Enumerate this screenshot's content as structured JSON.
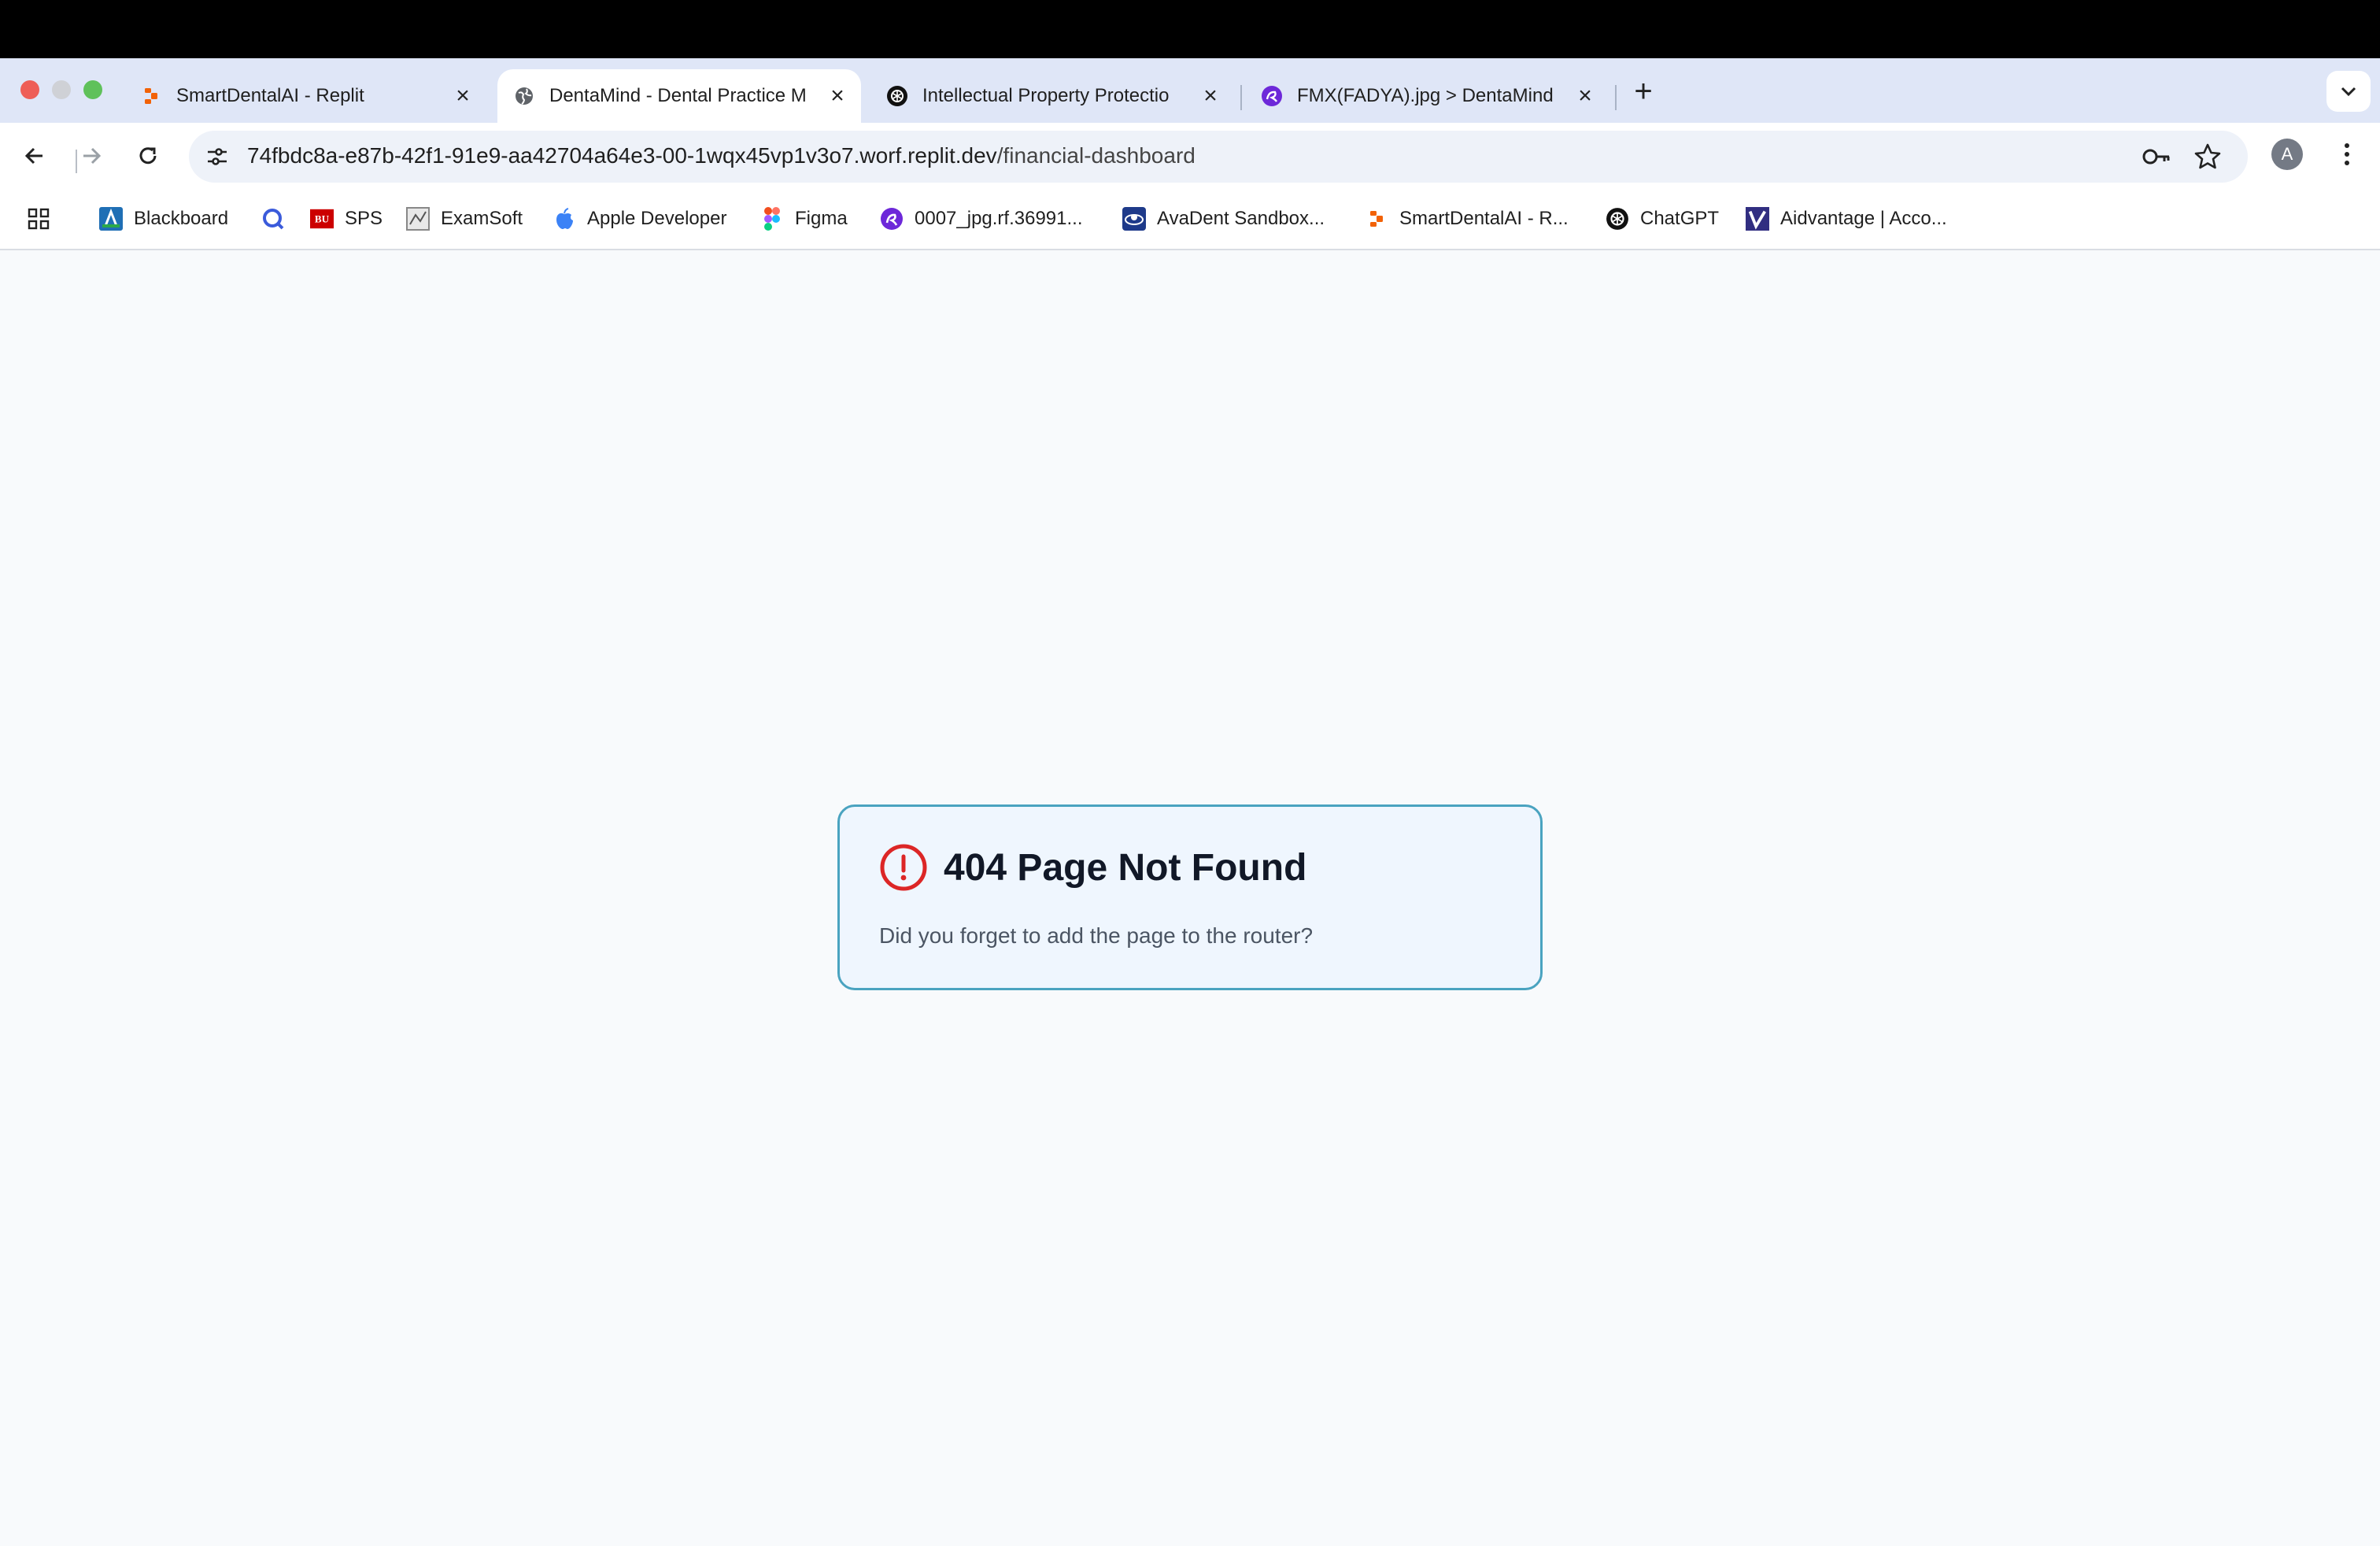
{
  "tabs": [
    {
      "title": "SmartDentalAI - Replit",
      "icon": "replit-icon",
      "active": false
    },
    {
      "title": "DentaMind - Dental Practice M",
      "icon": "globe-icon",
      "active": true
    },
    {
      "title": "Intellectual Property Protectio",
      "icon": "openai-icon",
      "active": false
    },
    {
      "title": "FMX(FADYA).jpg > DentaMind",
      "icon": "roboflow-icon",
      "active": false
    }
  ],
  "address_bar": {
    "host": "74fbdc8a-e87b-42f1-91e9-aa42704a64e3-00-1wqx45vp1v3o7.worf.replit.dev",
    "path": "/financial-dashboard"
  },
  "profile": {
    "initial": "A"
  },
  "bookmarks": [
    {
      "label": "Blackboard",
      "icon": "blackboard-icon"
    },
    {
      "label": "",
      "icon": "q-icon"
    },
    {
      "label": "SPS",
      "icon": "bu-icon"
    },
    {
      "label": "ExamSoft",
      "icon": "examsoft-icon"
    },
    {
      "label": "Apple Developer",
      "icon": "apple-icon"
    },
    {
      "label": "Figma",
      "icon": "figma-icon"
    },
    {
      "label": "0007_jpg.rf.36991...",
      "icon": "roboflow-icon"
    },
    {
      "label": "AvaDent Sandbox...",
      "icon": "avadent-icon"
    },
    {
      "label": "SmartDentalAI - R...",
      "icon": "replit-icon"
    },
    {
      "label": "ChatGPT",
      "icon": "openai-icon"
    },
    {
      "label": "Aidvantage | Acco...",
      "icon": "aidvantage-icon"
    }
  ],
  "error_card": {
    "title": "404 Page Not Found",
    "message": "Did you forget to add the page to the router?",
    "icon": "alert-circle-icon"
  },
  "colors": {
    "accent_red": "#dc2626",
    "card_border": "#4aa3c0",
    "card_bg": "#eff6fe",
    "page_bg": "#f8fafc"
  }
}
